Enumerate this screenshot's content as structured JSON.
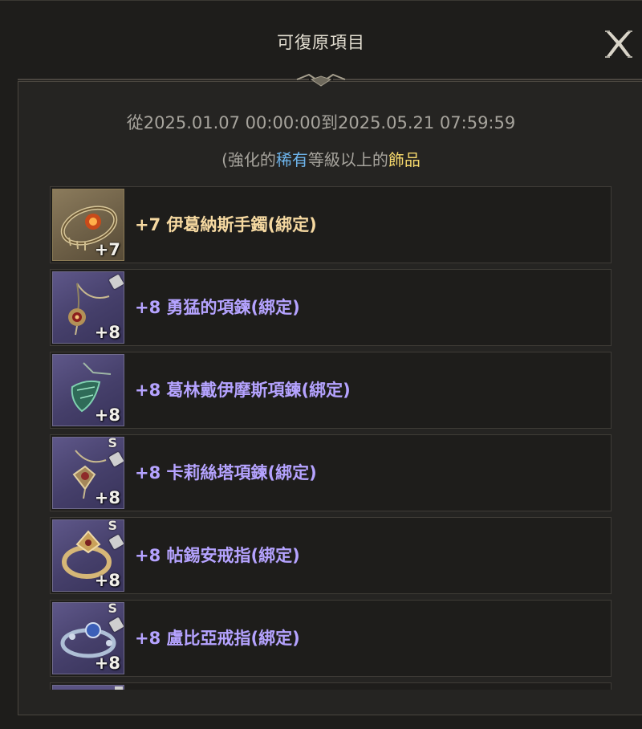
{
  "dialog": {
    "title": "可復原項目",
    "close_icon": "close-x-icon"
  },
  "period": {
    "text": "從2025.01.07 00:00:00到2025.05.21 07:59:59"
  },
  "condition": {
    "prefix": "(強化的",
    "rarity": "稀有",
    "middle": "等級以上的",
    "category": "飾品",
    "rarity_color": "#6db3ea",
    "category_color": "#f3d66b"
  },
  "items": [
    {
      "name": "+7 伊葛納斯手鐲(綁定)",
      "level": "+7",
      "grade": "legendary",
      "name_color": "#f6d9a1",
      "s_mark": "",
      "lock_icon": false,
      "icon": "bracelet-icon"
    },
    {
      "name": "+8 勇猛的項鍊(綁定)",
      "level": "+8",
      "grade": "rare",
      "name_color": "#b5a3ff",
      "s_mark": "",
      "lock_icon": true,
      "icon": "necklace-icon"
    },
    {
      "name": "+8 葛林戴伊摩斯項鍊(綁定)",
      "level": "+8",
      "grade": "rare",
      "name_color": "#b5a3ff",
      "s_mark": "",
      "lock_icon": false,
      "icon": "necklace-icon"
    },
    {
      "name": "+8 卡莉絲塔項鍊(綁定)",
      "level": "+8",
      "grade": "rare",
      "name_color": "#b5a3ff",
      "s_mark": "S",
      "lock_icon": true,
      "icon": "necklace-icon"
    },
    {
      "name": "+8 帖錫安戒指(綁定)",
      "level": "+8",
      "grade": "rare",
      "name_color": "#b5a3ff",
      "s_mark": "S",
      "lock_icon": true,
      "icon": "ring-icon"
    },
    {
      "name": "+8 盧比亞戒指(綁定)",
      "level": "+8",
      "grade": "rare",
      "name_color": "#b5a3ff",
      "s_mark": "S",
      "lock_icon": true,
      "icon": "ring-icon"
    }
  ]
}
